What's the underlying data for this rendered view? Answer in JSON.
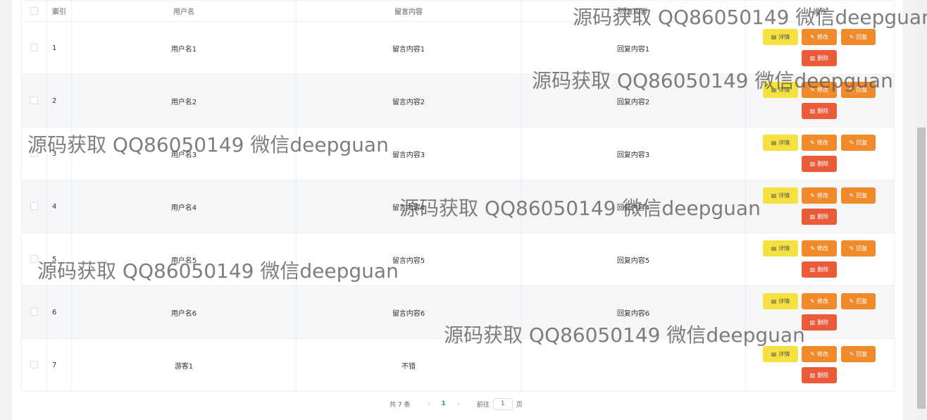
{
  "table": {
    "headers": {
      "index": "索引",
      "username": "用户名",
      "message": "留言内容",
      "reply": "回复内容",
      "actions": "操作"
    },
    "rows": [
      {
        "index": "1",
        "username": "用户名1",
        "message": "留言内容1",
        "reply": "回复内容1"
      },
      {
        "index": "2",
        "username": "用户名2",
        "message": "留言内容2",
        "reply": "回复内容2"
      },
      {
        "index": "3",
        "username": "用户名3",
        "message": "留言内容3",
        "reply": "回复内容3"
      },
      {
        "index": "4",
        "username": "用户名4",
        "message": "留言内容4",
        "reply": "回复内容4"
      },
      {
        "index": "5",
        "username": "用户名5",
        "message": "留言内容5",
        "reply": "回复内容5"
      },
      {
        "index": "6",
        "username": "用户名6",
        "message": "留言内容6",
        "reply": "回复内容6"
      },
      {
        "index": "7",
        "username": "游客1",
        "message": "不错",
        "reply": ""
      }
    ],
    "buttons": {
      "detail": "详情",
      "edit": "修改",
      "reply": "回复",
      "delete": "删除"
    }
  },
  "pagination": {
    "total": "共 7 条",
    "prev": "‹",
    "current_page": "1",
    "next": "›",
    "goto_label": "前往",
    "jump_value": "1",
    "page_suffix": "页"
  },
  "watermark": {
    "text": "源码获取 QQ86050149 微信deepguan"
  },
  "colors": {
    "detail_button": "#f5e13f",
    "edit_button": "#f08a2b",
    "reply_button": "#f08a2b",
    "delete_button": "#ea5b3a",
    "active_page": "#2aa36a"
  },
  "icons": {
    "detail": "document-icon",
    "edit": "edit-icon",
    "reply": "edit-icon",
    "delete": "trash-icon"
  }
}
